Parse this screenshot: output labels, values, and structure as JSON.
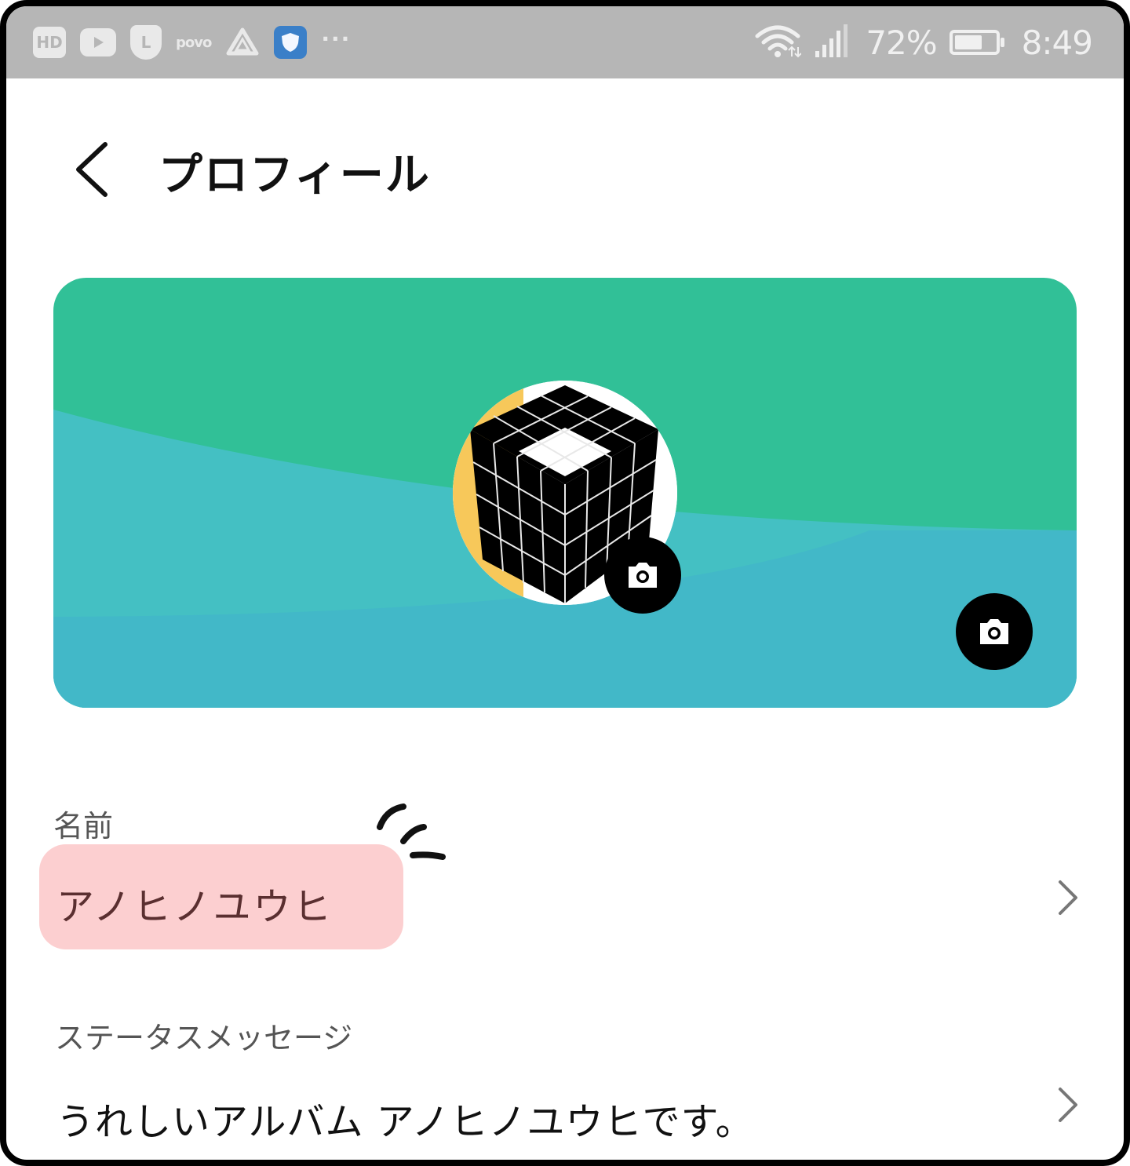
{
  "status_bar": {
    "left_icons": [
      "hd-icon",
      "youtube-icon",
      "l-shield-icon",
      "povo-icon",
      "drive-icon",
      "vpn-shield-icon",
      "more-dots-icon"
    ],
    "hd_label": "HD",
    "l_label": "L",
    "povo_label": "povo",
    "dots": "···",
    "battery_percent": "72%",
    "battery_level": 0.72,
    "time": "8:49"
  },
  "header": {
    "title": "プロフィール"
  },
  "banner": {
    "colors": {
      "top": "#31c097",
      "bottom": "#42b8c8",
      "avatar_accent": "#f7c85a",
      "camera_button": "#000000"
    }
  },
  "profile": {
    "name_label": "名前",
    "name_value": "アノヒノユウヒ",
    "status_label": "ステータスメッセージ",
    "status_value": "うれしいアルバム アノヒノユウヒです。"
  },
  "colors": {
    "highlight": "#fccfd0",
    "name_text": "#5a2f30",
    "status_bar": "#b6b6b6"
  }
}
